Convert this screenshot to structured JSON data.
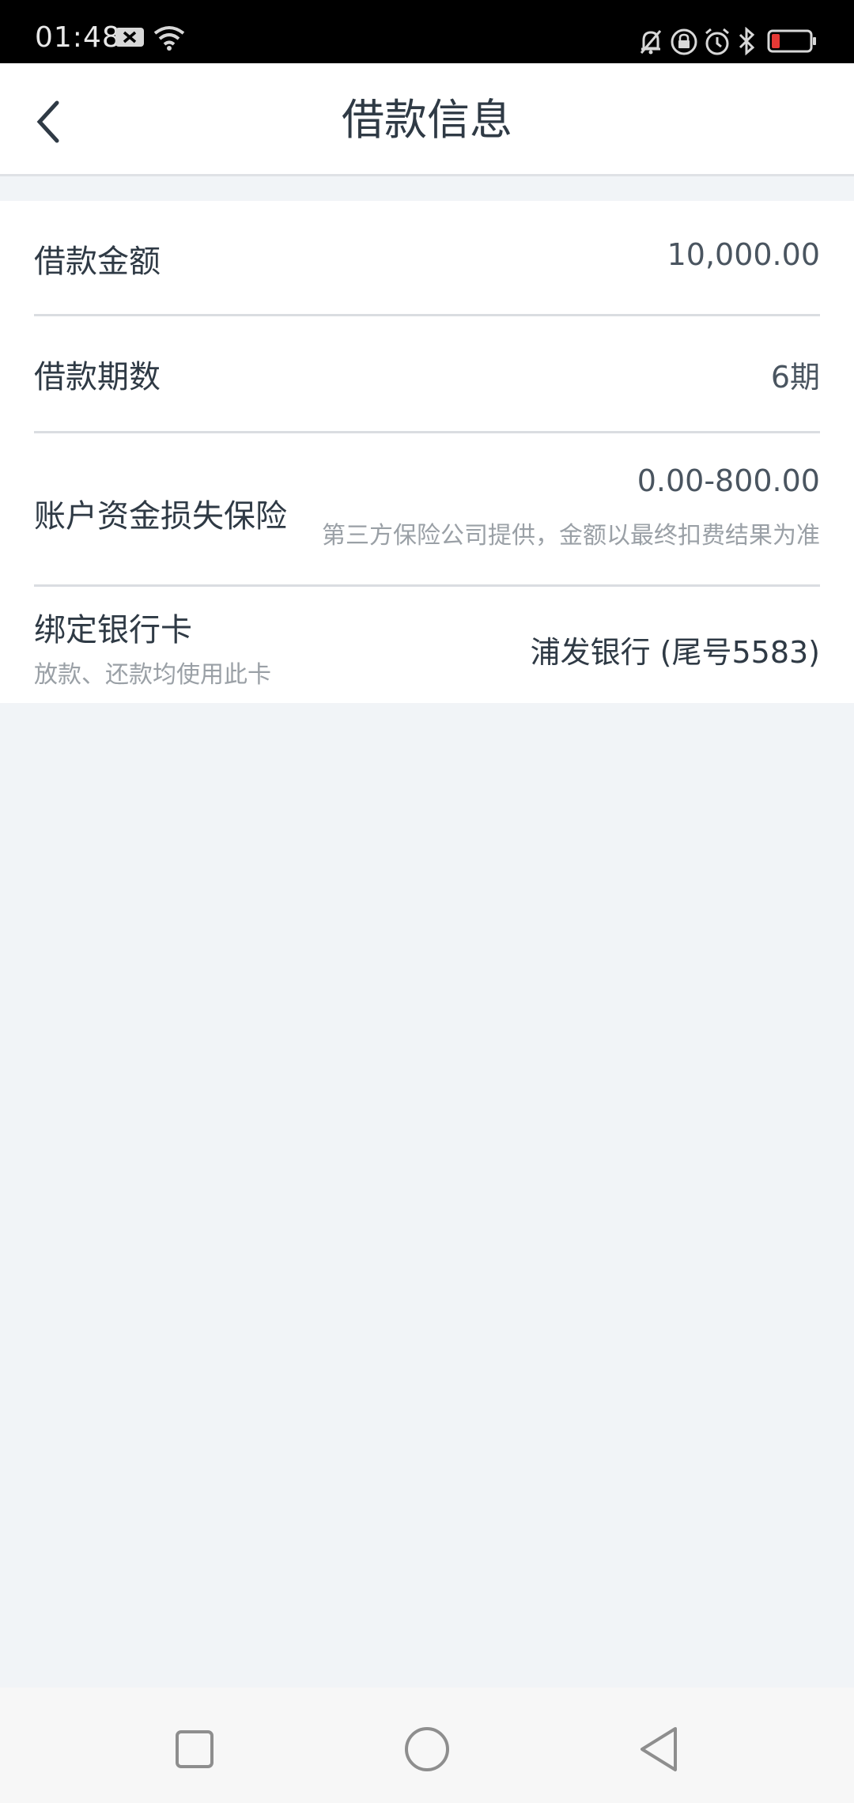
{
  "status_bar": {
    "time": "01:48",
    "left_icons": [
      "message-x-icon",
      "wifi-icon"
    ],
    "right_icons": [
      "bell-muted-icon",
      "lock-rotation-icon",
      "alarm-icon",
      "bluetooth-icon",
      "battery-low-icon"
    ],
    "battery_color": "#e53935"
  },
  "header": {
    "title": "借款信息",
    "back_icon": "chevron-left-icon"
  },
  "rows": [
    {
      "label": "借款金额",
      "value": "10,000.00"
    },
    {
      "label": "借款期数",
      "value": "6期"
    },
    {
      "label": "账户资金损失保险",
      "value": "0.00-800.00",
      "value_note": "第三方保险公司提供，金额以最终扣费结果为准"
    },
    {
      "label": "绑定银行卡",
      "label_note": "放款、还款均使用此卡",
      "value": "浦发银行 (尾号5583)"
    }
  ],
  "nav_bar": {
    "buttons": [
      "recent-apps-icon",
      "home-icon",
      "back-triangle-icon"
    ]
  },
  "colors": {
    "background": "#f1f4f7",
    "text_primary": "#2f3a45",
    "text_secondary": "#9aa0a6"
  }
}
